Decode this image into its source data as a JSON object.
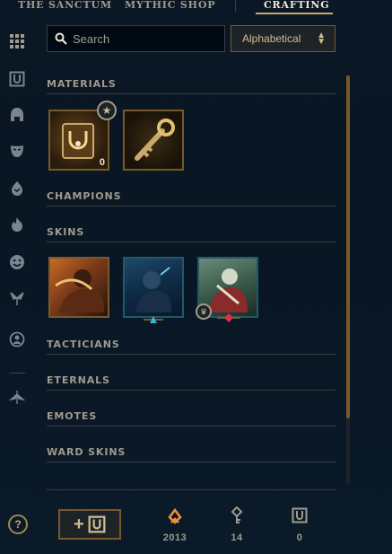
{
  "nav": {
    "tabs": [
      {
        "label": "THE SANCTUM"
      },
      {
        "label": "MYTHIC SHOP"
      },
      {
        "label": "CRAFTING"
      }
    ],
    "active": "CRAFTING"
  },
  "sidebar": {
    "icons": [
      "grid-icon",
      "chest-icon",
      "helmet-icon",
      "mask-icon",
      "egg-icon",
      "flame-icon",
      "emote-icon",
      "ward-icon",
      "profile-icon",
      "wings-icon"
    ]
  },
  "search": {
    "placeholder": "Search",
    "value": ""
  },
  "sort": {
    "selected": "Alphabetical"
  },
  "sections": {
    "materials": "MATERIALS",
    "champions": "CHAMPIONS",
    "skins": "SKINS",
    "tacticians": "TACTICIANS",
    "eternals": "ETERNALS",
    "emotes": "EMOTES",
    "ward_skins": "WARD SKINS"
  },
  "materials": [
    {
      "name": "Hextech Chest",
      "count": "0"
    },
    {
      "name": "Hextech Key"
    }
  ],
  "skins": [
    {
      "name": "skin-1"
    },
    {
      "name": "skin-2"
    },
    {
      "name": "skin-3"
    }
  ],
  "footer": {
    "add_label": "+",
    "currencies": [
      {
        "icon": "orange-essence-icon",
        "value": "2013"
      },
      {
        "icon": "key-fragment-icon",
        "value": "14"
      },
      {
        "icon": "chest-icon",
        "value": "0"
      }
    ],
    "help": "?"
  },
  "colors": {
    "gold": "#c8aa6e",
    "gold_dark": "#785a28",
    "text": "#a09b8c",
    "orange": "#f0903c"
  }
}
